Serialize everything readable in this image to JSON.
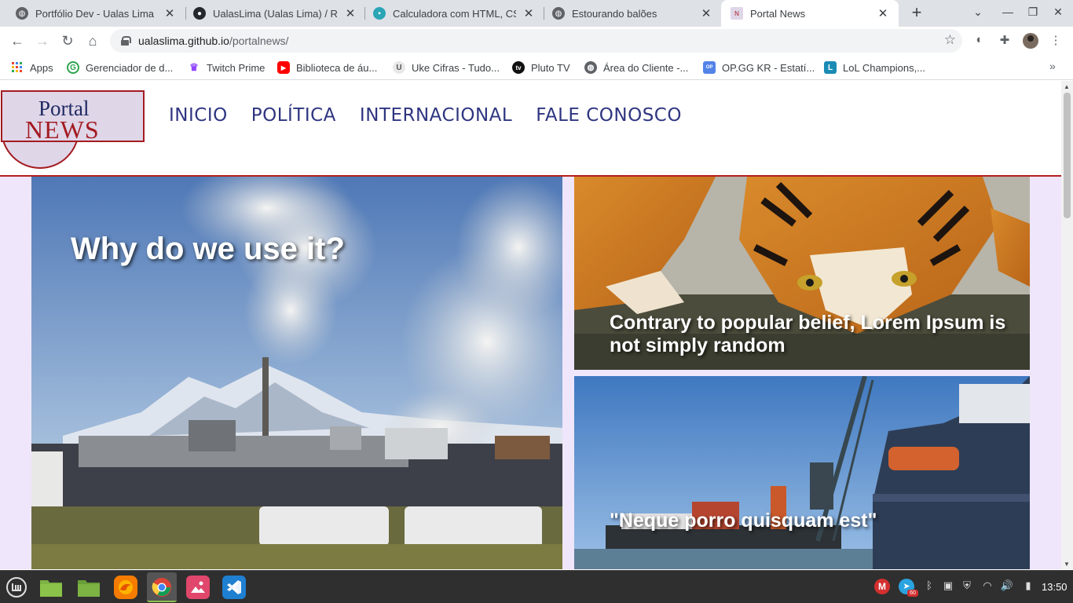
{
  "browser": {
    "tabs": [
      {
        "title": "Portfólio Dev - Ualas Lima D",
        "icon": "globe-icon",
        "active": false
      },
      {
        "title": "UalasLima (Ualas Lima) / Re",
        "icon": "github-icon",
        "active": false
      },
      {
        "title": "Calculadora com HTML, CSS",
        "icon": "calculator-icon",
        "active": false
      },
      {
        "title": "Estourando balões",
        "icon": "globe-icon",
        "active": false
      },
      {
        "title": "Portal News",
        "icon": "portal-news-icon",
        "active": true
      }
    ],
    "new_tab": "+",
    "address": {
      "host": "ualaslima.github.io",
      "path": "/portalnews/"
    },
    "bookmarks": [
      {
        "label": "Apps",
        "icon": "apps-grid-icon"
      },
      {
        "label": "Gerenciador de d...",
        "icon": "gerenciador-icon"
      },
      {
        "label": "Twitch Prime",
        "icon": "crown-icon"
      },
      {
        "label": "Biblioteca de áu...",
        "icon": "youtube-icon"
      },
      {
        "label": "Uke Cifras - Tudo...",
        "icon": "uke-icon"
      },
      {
        "label": "Pluto TV",
        "icon": "pluto-icon"
      },
      {
        "label": "Área do Cliente -...",
        "icon": "globe-icon"
      },
      {
        "label": "OP.GG KR - Estatí...",
        "icon": "opgg-icon"
      },
      {
        "label": "LoL Champions,...",
        "icon": "lol-icon"
      }
    ]
  },
  "site": {
    "logo": {
      "line1": "Portal",
      "line2": "NEWS"
    },
    "nav": [
      "INICIO",
      "POLÍTICA",
      "INTERNACIONAL",
      "FALE CONOSCO"
    ],
    "articles": [
      {
        "headline": "Why do we use it?",
        "image": "industrial-plant-mountain"
      },
      {
        "headline": "Contrary to popular belief, Lorem Ipsum is not simply random",
        "image": "tiger-drinking-water"
      },
      {
        "headline": "\"Neque porro quisquam est\"",
        "image": "harbor-ships-crane"
      }
    ]
  },
  "taskbar": {
    "apps": [
      "mint-menu-icon",
      "folder-icon",
      "files-icon",
      "firefox-icon",
      "chrome-icon",
      "image-viewer-icon",
      "vscode-icon"
    ],
    "clock": "13:50",
    "badge": "60"
  },
  "colors": {
    "accent_red": "#a31b21",
    "nav_blue": "#2e3580",
    "page_bg": "#efe6fb"
  }
}
